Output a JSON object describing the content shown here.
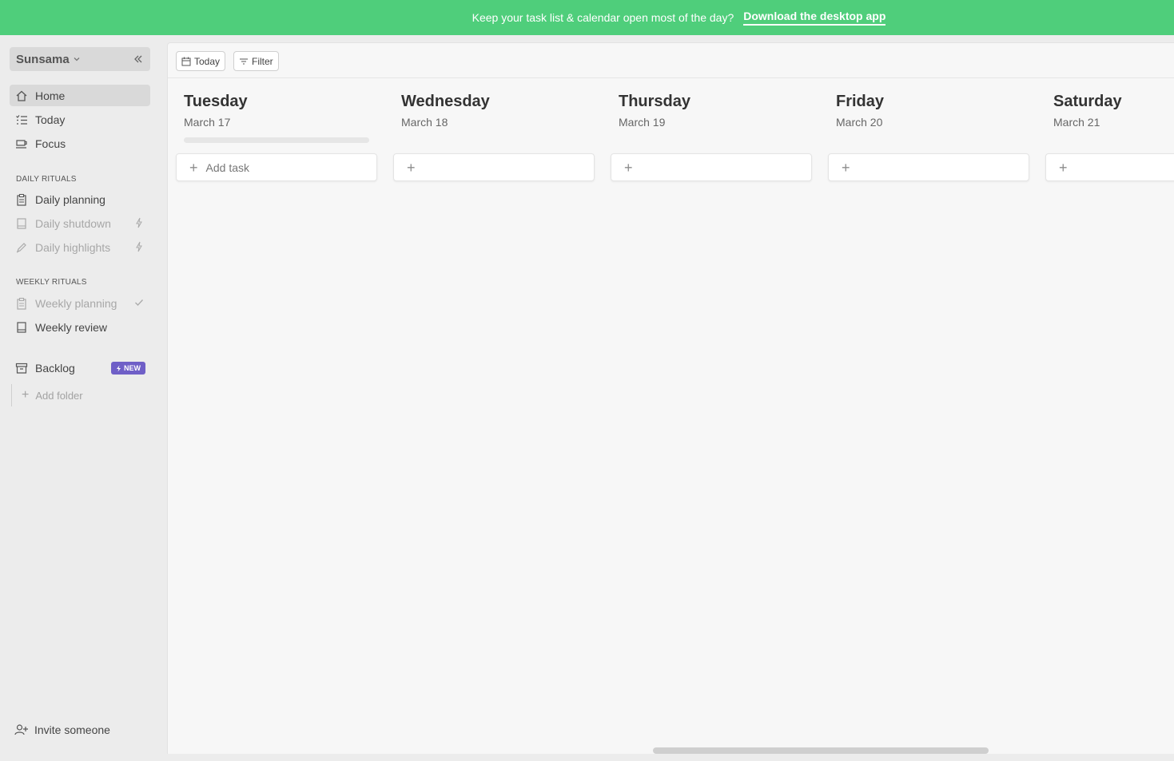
{
  "banner": {
    "message": "Keep your task list & calendar open most of the day?",
    "cta": "Download the desktop app"
  },
  "sidebar": {
    "workspace": "Sunsama",
    "nav": [
      {
        "label": "Home",
        "icon": "home-icon"
      },
      {
        "label": "Today",
        "icon": "list-icon"
      },
      {
        "label": "Focus",
        "icon": "coffee-icon"
      }
    ],
    "daily_rituals_label": "DAILY RITUALS",
    "daily_rituals": [
      {
        "label": "Daily planning",
        "icon": "clipboard-icon"
      },
      {
        "label": "Daily shutdown",
        "icon": "book-icon",
        "trail": "bolt-icon"
      },
      {
        "label": "Daily highlights",
        "icon": "pen-icon",
        "trail": "bolt-icon"
      }
    ],
    "weekly_rituals_label": "WEEKLY RITUALS",
    "weekly_rituals": [
      {
        "label": "Weekly planning",
        "icon": "clipboard-icon",
        "trail": "check-icon"
      },
      {
        "label": "Weekly review",
        "icon": "book-icon"
      }
    ],
    "backlog": {
      "label": "Backlog",
      "badge": "NEW"
    },
    "add_folder": "Add folder",
    "invite": "Invite someone"
  },
  "toolbar": {
    "today_label": "Today",
    "filter_label": "Filter"
  },
  "days": [
    {
      "name": "Tuesday",
      "date": "March 17",
      "add_label": "Add task"
    },
    {
      "name": "Wednesday",
      "date": "March 18",
      "add_label": ""
    },
    {
      "name": "Thursday",
      "date": "March 19",
      "add_label": ""
    },
    {
      "name": "Friday",
      "date": "March 20",
      "add_label": ""
    },
    {
      "name": "Saturday",
      "date": "March 21",
      "add_label": ""
    }
  ],
  "colors": {
    "banner": "#4fce7b",
    "badge": "#6f5fc7"
  }
}
